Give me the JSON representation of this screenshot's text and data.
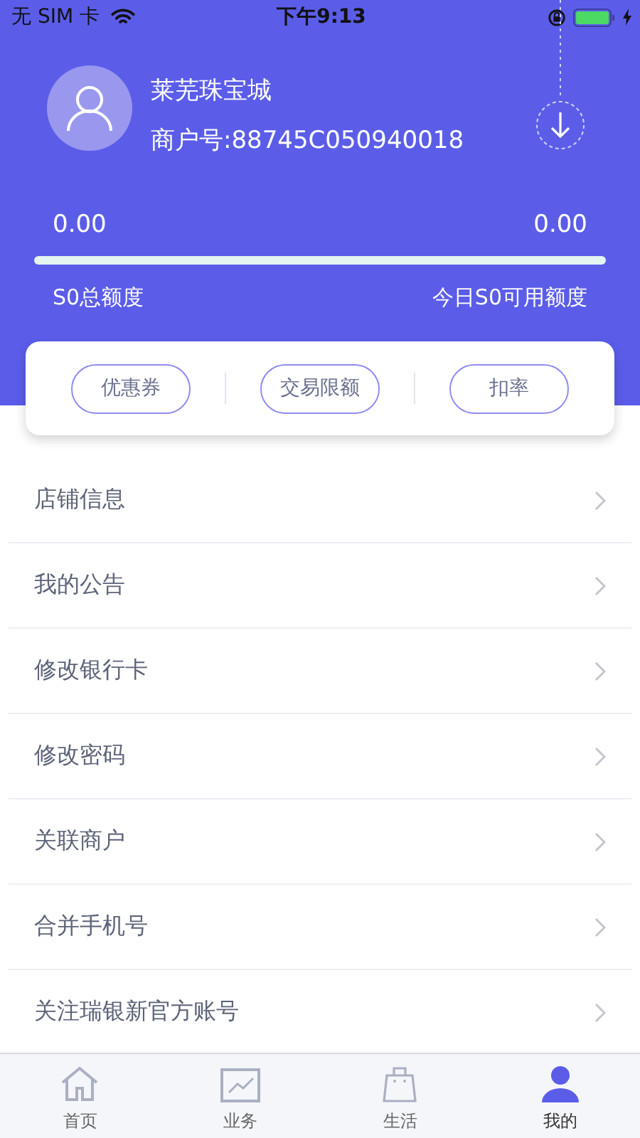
{
  "status_bar": {
    "carrier": "无 SIM 卡",
    "time": "下午9:13"
  },
  "profile": {
    "name": "莱芜珠宝城",
    "merchant_no": "商户号:88745C050940018"
  },
  "quota": {
    "left_value": "0.00",
    "right_value": "0.00",
    "left_label": "S0总额度",
    "right_label": "今日S0可用额度"
  },
  "actions": [
    "优惠券",
    "交易限额",
    "扣率"
  ],
  "menu": [
    "店铺信息",
    "我的公告",
    "修改银行卡",
    "修改密码",
    "关联商户",
    "合并手机号",
    "关注瑞银新官方账号"
  ],
  "tabs": [
    {
      "label": "首页",
      "kind": "home",
      "selected": false
    },
    {
      "label": "业务",
      "kind": "chart",
      "selected": false
    },
    {
      "label": "生活",
      "kind": "bag",
      "selected": false
    },
    {
      "label": "我的",
      "kind": "person",
      "selected": true
    }
  ]
}
